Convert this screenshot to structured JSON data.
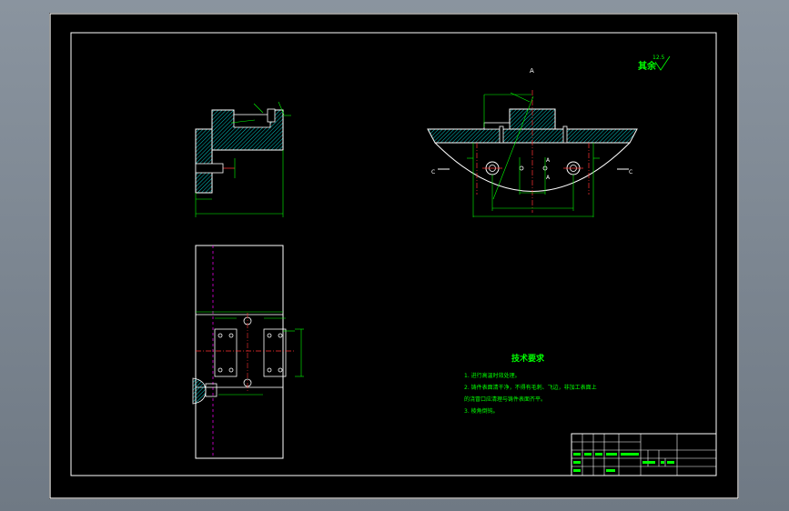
{
  "drawing": {
    "section_mark": "A",
    "section_c_left": "C",
    "section_c_right": "C",
    "a_label_1": "A",
    "a_label_2": "A",
    "roughness_label": "其余",
    "roughness_value": "12.5",
    "tech_req": {
      "title": "技术要求",
      "lines": [
        "1. 进行高温时效处理。",
        "2. 铸件表面清干净，不得有毛刺、飞边，非加工表面上",
        "   的浇冒口应清理与铸件表面齐平。",
        "3. 棱角倒钝。"
      ]
    }
  },
  "colors": {
    "sheet": "#000000",
    "frame": "#ffffff",
    "part": "#ffffff",
    "dimension": "#00ff00",
    "hatch": "#00ffff",
    "center": "#ff3333",
    "centerline_alt": "#ff00ff",
    "highlight": "#ffff00"
  }
}
